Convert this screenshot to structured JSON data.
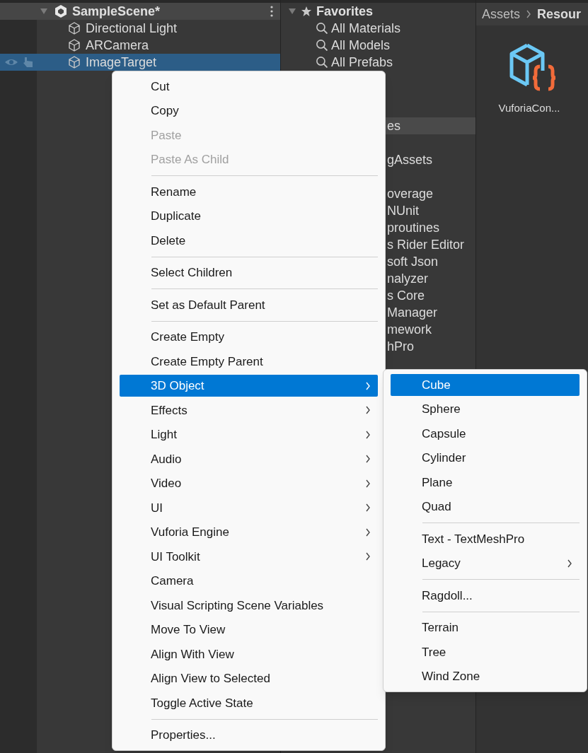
{
  "hierarchy": {
    "scene": {
      "title": "SampleScene*",
      "expanded": true
    },
    "items": [
      {
        "label": "Directional Light",
        "selected": false
      },
      {
        "label": "ARCamera",
        "selected": false
      },
      {
        "label": "ImageTarget",
        "selected": true
      }
    ]
  },
  "project": {
    "favorites": {
      "label": "Favorites",
      "expanded": true,
      "items": [
        "All Materials",
        "All Models",
        "All Prefabs"
      ]
    },
    "folder_groups": [
      [
        {
          "label": "es",
          "selected": true
        }
      ],
      [
        {
          "label": "gAssets",
          "selected": false
        }
      ],
      [
        {
          "label": "overage",
          "selected": false
        },
        {
          "label": "NUnit",
          "selected": false
        },
        {
          "label": "proutines",
          "selected": false
        },
        {
          "label": "s Rider Editor",
          "selected": false
        },
        {
          "label": "soft Json",
          "selected": false
        },
        {
          "label": "nalyzer",
          "selected": false
        },
        {
          "label": "s Core",
          "selected": false
        },
        {
          "label": "Manager",
          "selected": false
        },
        {
          "label": "mework",
          "selected": false
        },
        {
          "label": "hPro",
          "selected": false
        }
      ]
    ]
  },
  "assets": {
    "breadcrumb": [
      "Assets",
      "Resour"
    ],
    "files": [
      {
        "name": "VuforiaCon..."
      }
    ]
  },
  "context_menu": [
    {
      "kind": "item",
      "label": "Cut",
      "disabled": false,
      "submenu": false,
      "selected": false
    },
    {
      "kind": "item",
      "label": "Copy",
      "disabled": false,
      "submenu": false,
      "selected": false
    },
    {
      "kind": "item",
      "label": "Paste",
      "disabled": true,
      "submenu": false,
      "selected": false
    },
    {
      "kind": "item",
      "label": "Paste As Child",
      "disabled": true,
      "submenu": false,
      "selected": false
    },
    {
      "kind": "separator"
    },
    {
      "kind": "item",
      "label": "Rename",
      "disabled": false,
      "submenu": false,
      "selected": false
    },
    {
      "kind": "item",
      "label": "Duplicate",
      "disabled": false,
      "submenu": false,
      "selected": false
    },
    {
      "kind": "item",
      "label": "Delete",
      "disabled": false,
      "submenu": false,
      "selected": false
    },
    {
      "kind": "separator"
    },
    {
      "kind": "item",
      "label": "Select Children",
      "disabled": false,
      "submenu": false,
      "selected": false
    },
    {
      "kind": "separator"
    },
    {
      "kind": "item",
      "label": "Set as Default Parent",
      "disabled": false,
      "submenu": false,
      "selected": false
    },
    {
      "kind": "separator"
    },
    {
      "kind": "item",
      "label": "Create Empty",
      "disabled": false,
      "submenu": false,
      "selected": false
    },
    {
      "kind": "item",
      "label": "Create Empty Parent",
      "disabled": false,
      "submenu": false,
      "selected": false
    },
    {
      "kind": "item",
      "label": "3D Object",
      "disabled": false,
      "submenu": true,
      "selected": true
    },
    {
      "kind": "item",
      "label": "Effects",
      "disabled": false,
      "submenu": true,
      "selected": false
    },
    {
      "kind": "item",
      "label": "Light",
      "disabled": false,
      "submenu": true,
      "selected": false
    },
    {
      "kind": "item",
      "label": "Audio",
      "disabled": false,
      "submenu": true,
      "selected": false
    },
    {
      "kind": "item",
      "label": "Video",
      "disabled": false,
      "submenu": true,
      "selected": false
    },
    {
      "kind": "item",
      "label": "UI",
      "disabled": false,
      "submenu": true,
      "selected": false
    },
    {
      "kind": "item",
      "label": "Vuforia Engine",
      "disabled": false,
      "submenu": true,
      "selected": false
    },
    {
      "kind": "item",
      "label": "UI Toolkit",
      "disabled": false,
      "submenu": true,
      "selected": false
    },
    {
      "kind": "item",
      "label": "Camera",
      "disabled": false,
      "submenu": false,
      "selected": false
    },
    {
      "kind": "item",
      "label": "Visual Scripting Scene Variables",
      "disabled": false,
      "submenu": false,
      "selected": false
    },
    {
      "kind": "item",
      "label": "Move To View",
      "disabled": false,
      "submenu": false,
      "selected": false
    },
    {
      "kind": "item",
      "label": "Align With View",
      "disabled": false,
      "submenu": false,
      "selected": false
    },
    {
      "kind": "item",
      "label": "Align View to Selected",
      "disabled": false,
      "submenu": false,
      "selected": false
    },
    {
      "kind": "item",
      "label": "Toggle Active State",
      "disabled": false,
      "submenu": false,
      "selected": false
    },
    {
      "kind": "separator"
    },
    {
      "kind": "item",
      "label": "Properties...",
      "disabled": false,
      "submenu": false,
      "selected": false
    }
  ],
  "submenu": [
    {
      "kind": "item",
      "label": "Cube",
      "disabled": false,
      "submenu": false,
      "selected": true
    },
    {
      "kind": "item",
      "label": "Sphere",
      "disabled": false,
      "submenu": false,
      "selected": false
    },
    {
      "kind": "item",
      "label": "Capsule",
      "disabled": false,
      "submenu": false,
      "selected": false
    },
    {
      "kind": "item",
      "label": "Cylinder",
      "disabled": false,
      "submenu": false,
      "selected": false
    },
    {
      "kind": "item",
      "label": "Plane",
      "disabled": false,
      "submenu": false,
      "selected": false
    },
    {
      "kind": "item",
      "label": "Quad",
      "disabled": false,
      "submenu": false,
      "selected": false
    },
    {
      "kind": "separator"
    },
    {
      "kind": "item",
      "label": "Text - TextMeshPro",
      "disabled": false,
      "submenu": false,
      "selected": false
    },
    {
      "kind": "item",
      "label": "Legacy",
      "disabled": false,
      "submenu": true,
      "selected": false
    },
    {
      "kind": "separator"
    },
    {
      "kind": "item",
      "label": "Ragdoll...",
      "disabled": false,
      "submenu": false,
      "selected": false
    },
    {
      "kind": "separator"
    },
    {
      "kind": "item",
      "label": "Terrain",
      "disabled": false,
      "submenu": false,
      "selected": false
    },
    {
      "kind": "item",
      "label": "Tree",
      "disabled": false,
      "submenu": false,
      "selected": false
    },
    {
      "kind": "item",
      "label": "Wind Zone",
      "disabled": false,
      "submenu": false,
      "selected": false
    }
  ]
}
